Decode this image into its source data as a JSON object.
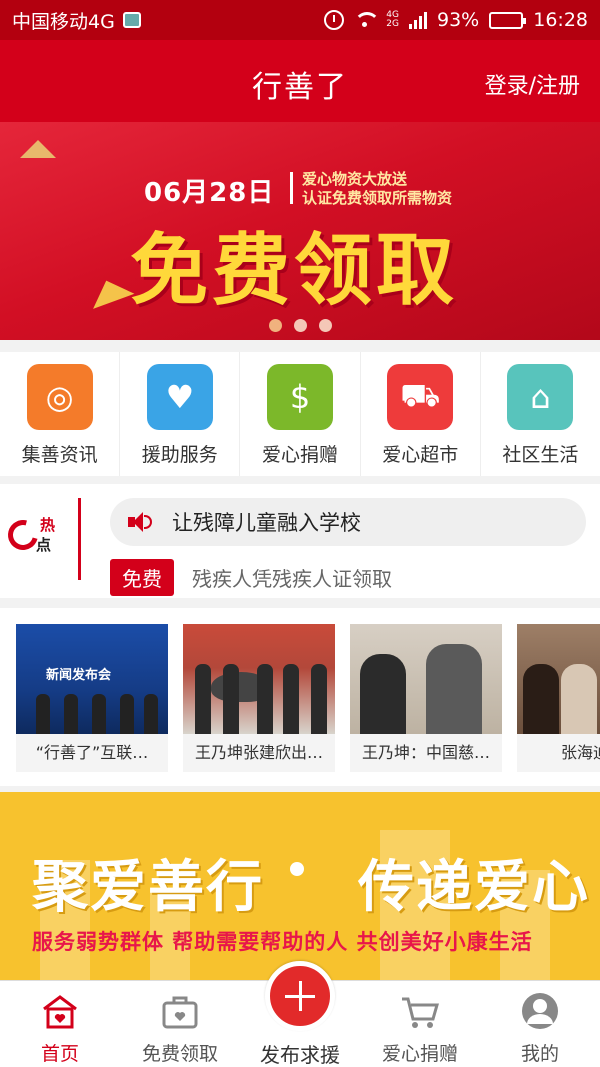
{
  "status_bar": {
    "carrier": "中国移动4G",
    "net_top": "4G",
    "net_bottom": "2G",
    "battery": "93%",
    "battery_level": 0.93,
    "time": "16:28"
  },
  "header": {
    "title": "行善了",
    "login": "登录/注册"
  },
  "banner": {
    "date": "06月28日",
    "sub_line1": "爱心物资大放送",
    "sub_line2": "认证免费领取所需物资",
    "headline": "免费领取",
    "slide_count": 3,
    "active_slide": 0
  },
  "nav": [
    {
      "label": "集善资讯",
      "icon": "target-icon",
      "color": "#f47b2a",
      "glyph": "◎"
    },
    {
      "label": "援助服务",
      "icon": "handshake-icon",
      "color": "#3aa4e6",
      "glyph": "♥"
    },
    {
      "label": "爱心捐赠",
      "icon": "money-heart-icon",
      "color": "#7cb82a",
      "glyph": "$"
    },
    {
      "label": "爱心超市",
      "icon": "cart-icon",
      "color": "#ee3b3b",
      "glyph": "⛟"
    },
    {
      "label": "社区生活",
      "icon": "community-icon",
      "color": "#58c4bc",
      "glyph": "⌂"
    }
  ],
  "hot": {
    "logo_top": "热",
    "logo_bottom": "点",
    "headline": "让残障儿童融入学校",
    "tag": "免费",
    "tag_text": "残疾人凭残疾人证领取"
  },
  "news": [
    {
      "caption": "“行善了”互联…",
      "image_text": "新闻发布会"
    },
    {
      "caption": "王乃坤张建欣出…"
    },
    {
      "caption": "王乃坤：中国慈…"
    },
    {
      "caption": "张海迪、"
    }
  ],
  "slogan": {
    "left": "聚爱善行",
    "right": "传递爱心",
    "sub": "服务弱势群体  帮助需要帮助的人  共创美好小康生活"
  },
  "tabbar": [
    {
      "label": "首页",
      "icon": "home-icon",
      "active": true
    },
    {
      "label": "免费领取",
      "icon": "gift-bag-icon",
      "active": false
    },
    {
      "label": "发布求援",
      "icon": "plus-icon",
      "active": false
    },
    {
      "label": "爱心捐赠",
      "icon": "donate-cart-icon",
      "active": false
    },
    {
      "label": "我的",
      "icon": "profile-icon",
      "active": false
    }
  ],
  "colors": {
    "brand_red": "#d3001a",
    "status_red": "#b3000f",
    "slogan_yellow": "#f7c22e",
    "headline_yellow": "#ffd83a"
  }
}
